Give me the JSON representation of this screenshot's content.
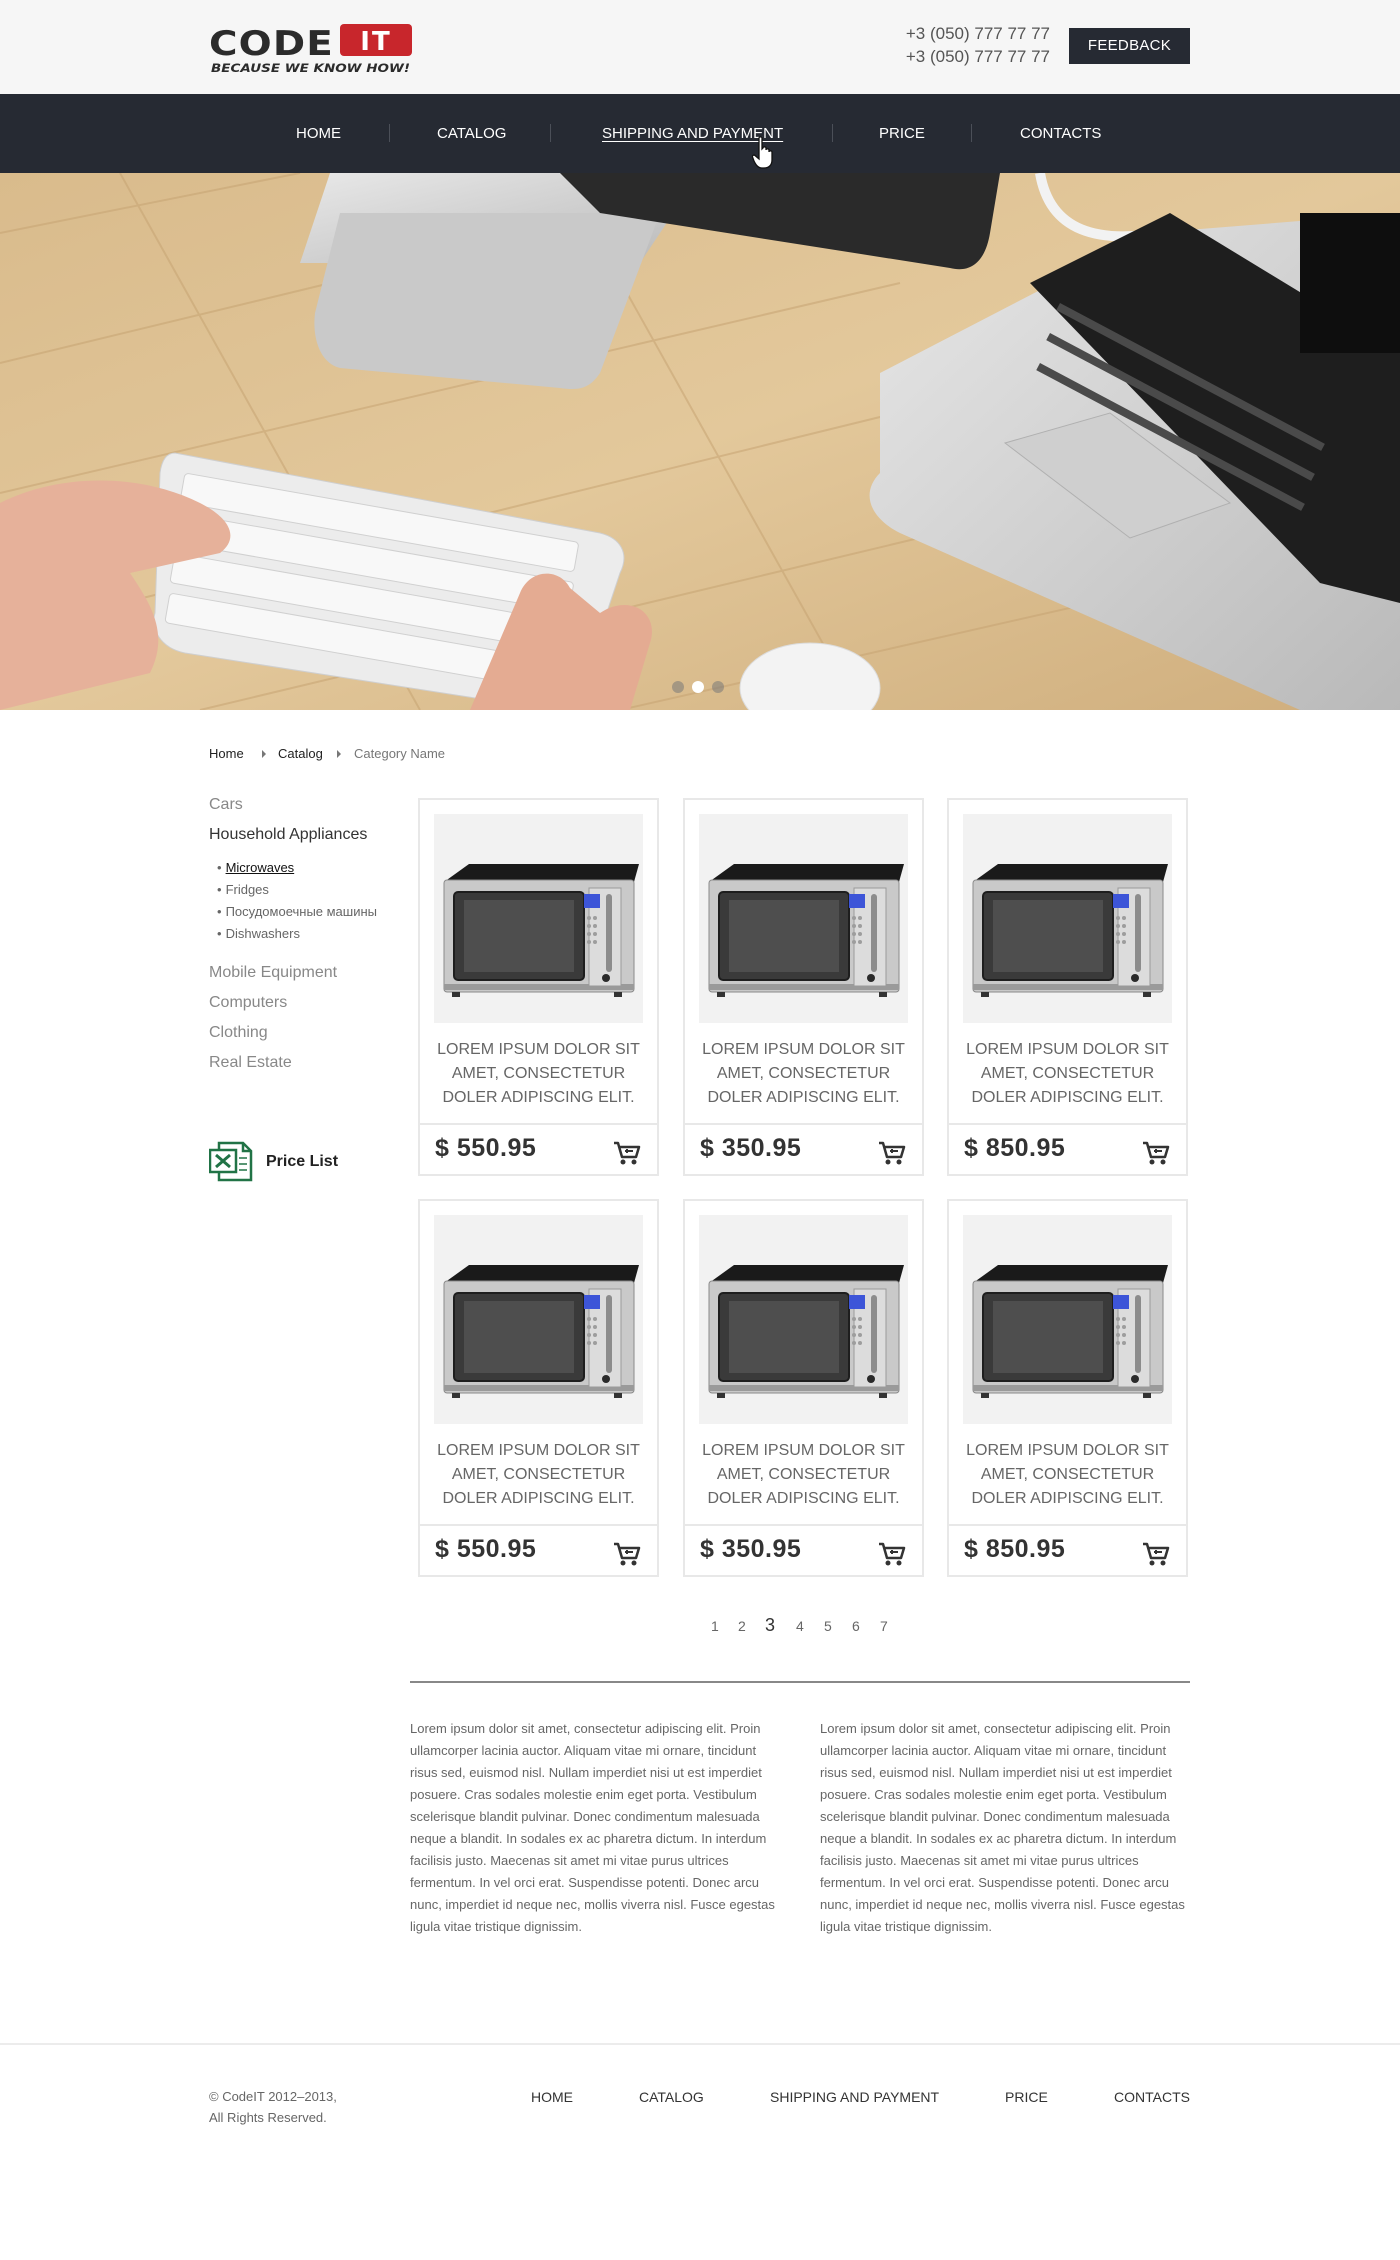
{
  "header": {
    "logo": {
      "main": "CODE",
      "badge": "IT",
      "tagline": "BECAUSE WE KNOW HOW!"
    },
    "phones": [
      "+3 (050) 777 77 77",
      "+3 (050) 777 77 77"
    ],
    "feedback_label": "FEEDBACK"
  },
  "nav": {
    "items": [
      {
        "label": "HOME"
      },
      {
        "label": "CATALOG"
      },
      {
        "label": "SHIPPING AND PAYMENT",
        "active": true
      },
      {
        "label": "PRICE"
      },
      {
        "label": "CONTACTS"
      }
    ]
  },
  "hero": {
    "slides": 3,
    "active_slide": 2
  },
  "breadcrumb": {
    "items": [
      "Home",
      "Catalog"
    ],
    "current": "Category Name"
  },
  "sidebar": {
    "categories": [
      {
        "label": "Cars"
      },
      {
        "label": "Household Appliances",
        "active": true
      },
      {
        "label": "Mobile Equipment"
      },
      {
        "label": "Computers"
      },
      {
        "label": "Clothing"
      },
      {
        "label": "Real Estate"
      }
    ],
    "subcategories": [
      {
        "label": "Microwaves",
        "active": true
      },
      {
        "label": "Fridges"
      },
      {
        "label": "Посудомоечные машины"
      },
      {
        "label": "Dishwashers"
      }
    ],
    "price_list_label": "Price List"
  },
  "products": [
    {
      "title": "LOREM IPSUM DOLOR SIT AMET, CONSECTETUR DOLER ADIPISCING ELIT.",
      "price": "$ 550.95"
    },
    {
      "title": "LOREM IPSUM DOLOR SIT AMET, CONSECTETUR DOLER ADIPISCING ELIT.",
      "price": "$ 350.95"
    },
    {
      "title": "LOREM IPSUM DOLOR SIT AMET, CONSECTETUR DOLER ADIPISCING ELIT.",
      "price": "$ 850.95"
    },
    {
      "title": "LOREM IPSUM DOLOR SIT AMET, CONSECTETUR DOLER ADIPISCING ELIT.",
      "price": "$ 550.95"
    },
    {
      "title": "LOREM IPSUM DOLOR SIT AMET, CONSECTETUR DOLER ADIPISCING ELIT.",
      "price": "$ 350.95"
    },
    {
      "title": "LOREM IPSUM DOLOR SIT AMET, CONSECTETUR DOLER ADIPISCING ELIT.",
      "price": "$ 850.95"
    }
  ],
  "pagination": {
    "pages": [
      "1",
      "2",
      "3",
      "4",
      "5",
      "6",
      "7"
    ],
    "current": "3"
  },
  "description": {
    "left": "Lorem ipsum dolor sit amet, consectetur adipiscing elit. Proin ullamcorper lacinia auctor. Aliquam vitae mi ornare, tincidunt risus sed, euismod nisl. Nullam imperdiet nisi ut est imperdiet posuere. Cras sodales molestie enim eget porta. Vestibulum scelerisque blandit pulvinar. Donec condimentum malesuada neque a blandit. In sodales ex ac pharetra dictum. In interdum facilisis justo. Maecenas sit amet mi vitae purus ultrices fermentum. In vel orci erat. Suspendisse potenti. Donec arcu nunc, imperdiet id neque nec, mollis viverra nisl. Fusce egestas ligula vitae tristique dignissim.",
    "right": "Lorem ipsum dolor sit amet, consectetur adipiscing elit. Proin ullamcorper lacinia auctor. Aliquam vitae mi ornare, tincidunt risus sed, euismod nisl. Nullam imperdiet nisi ut est imperdiet posuere. Cras sodales molestie enim eget porta. Vestibulum scelerisque blandit pulvinar. Donec condimentum malesuada neque a blandit. In sodales ex ac pharetra dictum. In interdum facilisis justo. Maecenas sit amet mi vitae purus ultrices fermentum. In vel orci erat. Suspendisse potenti. Donec arcu nunc, imperdiet id neque nec, mollis viverra nisl. Fusce egestas ligula vitae tristique dignissim."
  },
  "footer": {
    "copyright_line1": "© CodeIT 2012–2013,",
    "copyright_line2": "All Rights Reserved.",
    "nav": [
      "HOME",
      "CATALOG",
      "SHIPPING AND PAYMENT",
      "PRICE",
      "CONTACTS"
    ]
  },
  "colors": {
    "nav_bg": "#262a33",
    "logo_red": "#c8262c",
    "header_bg": "#f6f6f6",
    "excel_green": "#217346"
  },
  "icons": {
    "cart": "shopping-cart-icon",
    "price_list": "excel-file-icon",
    "cursor": "hand-pointer-icon"
  }
}
